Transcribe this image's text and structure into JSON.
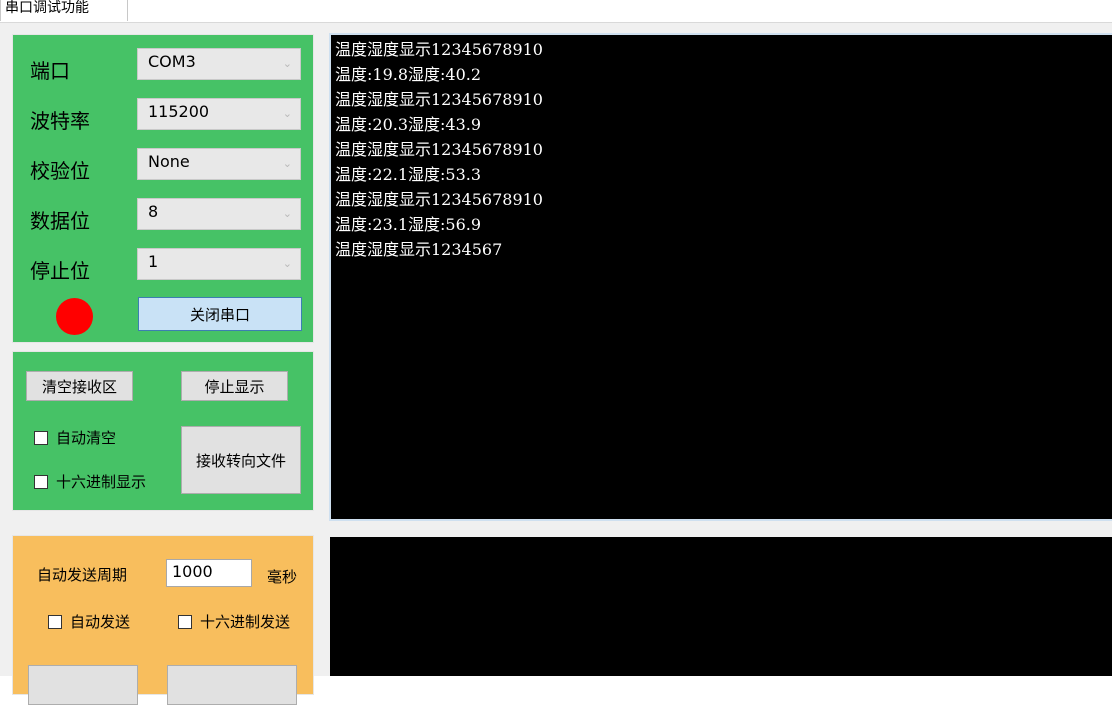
{
  "tab": {
    "label": "串口调试功能"
  },
  "port_settings": {
    "port_label": "端口",
    "port_value": "COM3",
    "baud_label": "波特率",
    "baud_value": "115200",
    "parity_label": "校验位",
    "parity_value": "None",
    "data_bits_label": "数据位",
    "data_bits_value": "8",
    "stop_bits_label": "停止位",
    "stop_bits_value": "1",
    "status_color": "#ff0000",
    "toggle_button": "关闭串口"
  },
  "receive_controls": {
    "clear_button": "清空接收区",
    "pause_button": "停止显示",
    "auto_clear": "自动清空",
    "hex_display": "十六进制显示",
    "to_file_button": "接收转向文件"
  },
  "receive_area": {
    "lines": [
      "温度湿度显示12345678910",
      "温度:19.8湿度:40.2",
      "温度湿度显示12345678910",
      "温度:20.3湿度:43.9",
      "温度湿度显示12345678910",
      "温度:22.1湿度:53.3",
      "温度湿度显示12345678910",
      "温度:23.1湿度:56.9",
      "温度湿度显示1234567"
    ]
  },
  "send_controls": {
    "period_label": "自动发送周期",
    "period_value": "1000",
    "unit_label": "毫秒",
    "auto_send": "自动发送",
    "hex_send": "十六进制发送"
  }
}
